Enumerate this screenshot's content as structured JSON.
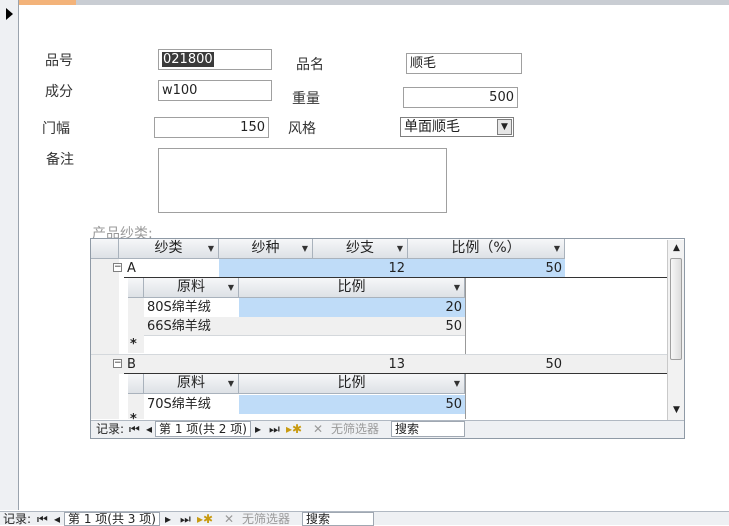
{
  "form": {
    "labels": {
      "pinhao": "品号",
      "pinming": "品名",
      "chengfen": "成分",
      "zhongliang": "重量",
      "menfu": "门幅",
      "fengge": "风格",
      "beizhu": "备注"
    },
    "values": {
      "pinhao": "021800",
      "pinming": "顺毛",
      "chengfen": "w100",
      "zhongliang": "500",
      "menfu": "150",
      "fengge": "单面顺毛"
    },
    "subform_label": "产品纱类:"
  },
  "subform": {
    "headers": [
      "纱类",
      "纱种",
      "纱支",
      "比例（%）"
    ],
    "nested_headers": [
      "原料",
      "比例"
    ],
    "groups": [
      {
        "yarn_type": "A",
        "yarn_count": "12",
        "ratio": "50",
        "rows": [
          {
            "material": "80S绵羊绒",
            "ratio": "20"
          },
          {
            "material": "66S绵羊绒",
            "ratio": "50"
          }
        ]
      },
      {
        "yarn_type": "B",
        "yarn_count": "13",
        "ratio": "50",
        "rows": [
          {
            "material": "70S绵羊绒",
            "ratio": "50"
          }
        ]
      }
    ],
    "new_row_marker": "*",
    "nav": {
      "label": "记录:",
      "position": "第 1 项(共 2 项)",
      "filter": "无筛选器",
      "search": "搜索"
    }
  },
  "main_nav": {
    "label": "记录:",
    "position": "第 1 项(共 3 项)",
    "filter": "无筛选器",
    "search": "搜索"
  },
  "colors": {
    "selection": "#bfdcf8",
    "accent_tab": "#f3b37a"
  }
}
